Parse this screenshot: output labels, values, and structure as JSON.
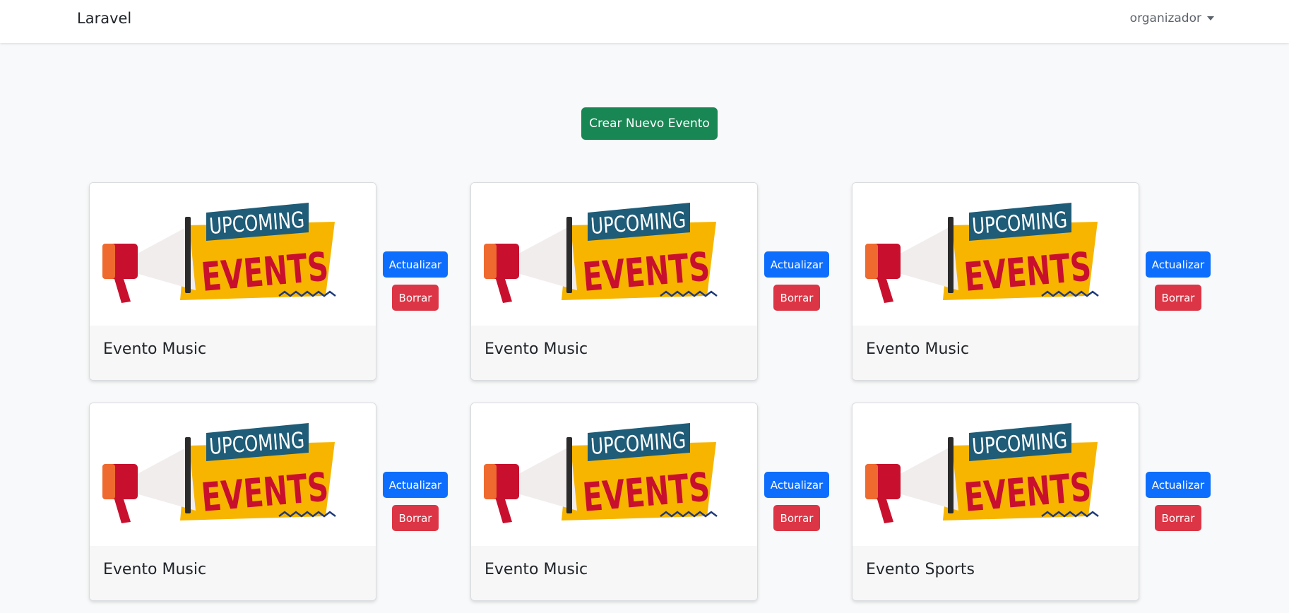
{
  "navbar": {
    "brand": "Laravel",
    "user": "organizador"
  },
  "main": {
    "create_label": "Crear Nuevo Evento",
    "image_text": {
      "line1": "UPCOMING",
      "line2": "EVENTS"
    },
    "events": [
      {
        "title": "Evento Music",
        "update_label": "Actualizar",
        "delete_label": "Borrar"
      },
      {
        "title": "Evento Music",
        "update_label": "Actualizar",
        "delete_label": "Borrar"
      },
      {
        "title": "Evento Music",
        "update_label": "Actualizar",
        "delete_label": "Borrar"
      },
      {
        "title": "Evento Music",
        "update_label": "Actualizar",
        "delete_label": "Borrar"
      },
      {
        "title": "Evento Music",
        "update_label": "Actualizar",
        "delete_label": "Borrar"
      },
      {
        "title": "Evento Sports",
        "update_label": "Actualizar",
        "delete_label": "Borrar"
      }
    ]
  },
  "colors": {
    "create": "#198754",
    "update": "#0d6efd",
    "delete": "#dc3545",
    "banner_blue": "#1f5c78",
    "banner_yellow": "#f7b500",
    "banner_red": "#c8102e"
  }
}
